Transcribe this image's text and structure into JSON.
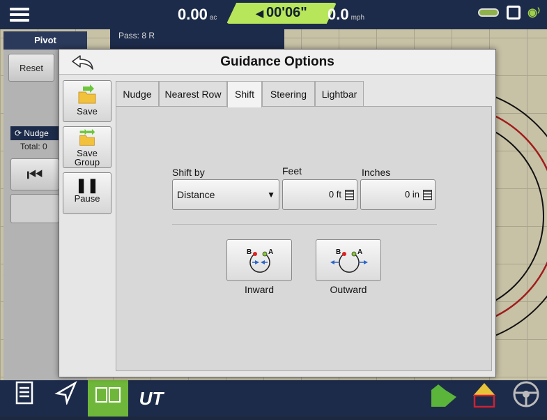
{
  "topbar": {
    "area_value": "0.00",
    "area_unit": "ac",
    "timer": "00'06\"",
    "speed_value": "0.0",
    "speed_unit": "mph"
  },
  "left_panel": {
    "title": "Pivot",
    "reset_label": "Reset",
    "nudge_label": "Nudge",
    "total_label": "Total: 0"
  },
  "map": {
    "pass_label": "Pass: 8 R"
  },
  "dialog": {
    "title": "Guidance Options",
    "side_buttons": {
      "save": "Save",
      "save_group_line1": "Save",
      "save_group_line2": "Group",
      "pause": "Pause"
    },
    "tabs": [
      "Nudge",
      "Nearest Row",
      "Shift",
      "Steering",
      "Lightbar"
    ],
    "active_tab": "Shift",
    "shift": {
      "shift_by_label": "Shift by",
      "shift_by_value": "Distance",
      "feet_label": "Feet",
      "feet_value": "0 ft",
      "inches_label": "Inches",
      "inches_value": "0 in",
      "inward_label": "Inward",
      "outward_label": "Outward",
      "point_b": "B",
      "point_a": "A"
    }
  },
  "bottombar": {
    "ut_label": "UT"
  },
  "colors": {
    "navy": "#1d2b4a",
    "accent_green": "#6fb73a",
    "timer_green": "#b7e65a",
    "map_bg": "#c7c1a6",
    "pivot_red": "#a01c1c"
  }
}
